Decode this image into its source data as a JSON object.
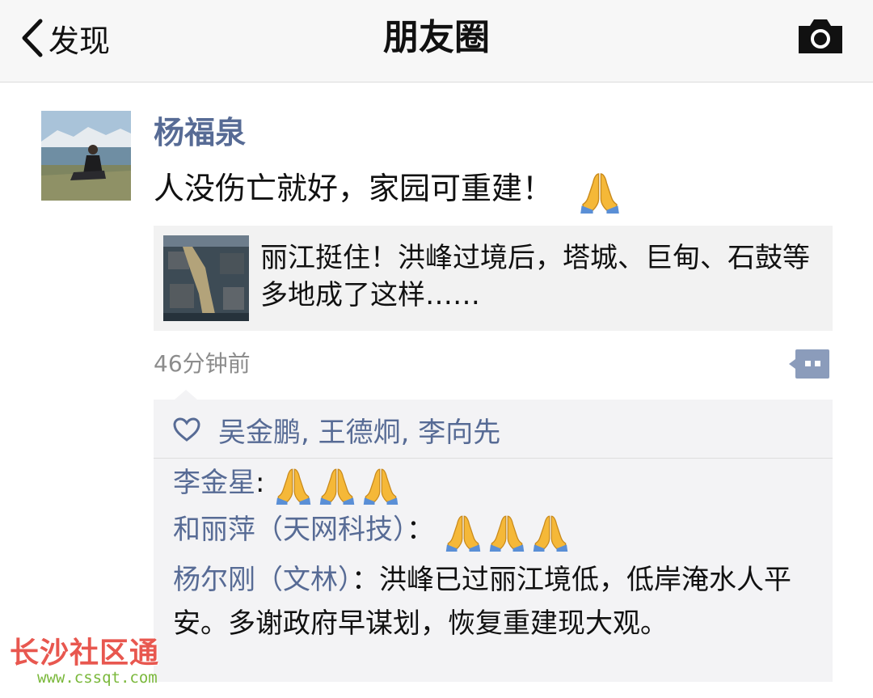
{
  "navbar": {
    "back_label": "发现",
    "title": "朋友圈",
    "camera_icon": "camera-icon"
  },
  "post": {
    "author": "杨福泉",
    "text": "人没伤亡就好，家园可重建！",
    "text_emoji": "folded-hands-emoji",
    "link_card": {
      "title": "丽江挺住！洪峰过境后，塔城、巨甸、石鼓等多地成了这样……"
    },
    "time": "46分钟前",
    "more_icon": "comment-more-icon"
  },
  "likes": {
    "icon": "heart-icon",
    "names": [
      "吴金鹏",
      "王德炯",
      "李向先"
    ]
  },
  "comments": [
    {
      "name": "李金星",
      "separator": ":",
      "text": "",
      "emoji_count": 3
    },
    {
      "name": "和丽萍（天网科技）",
      "separator": "：",
      "text": "",
      "emoji_count": 3
    },
    {
      "name": "杨尔刚（文林）",
      "separator": "：",
      "text": "洪峰已过丽江境低，低岸淹水人平安。多谢政府早谋划，恢复重建现大观。",
      "emoji_count": 0
    }
  ],
  "watermark": {
    "title": "长沙社区通",
    "url": "www.cssqt.com"
  },
  "colors": {
    "link_blue": "#576b95",
    "navbar_bg": "#f7f7f7",
    "feedback_bg": "#f3f3f5",
    "watermark_red": "#e8574f",
    "watermark_green": "#7ab83b"
  }
}
